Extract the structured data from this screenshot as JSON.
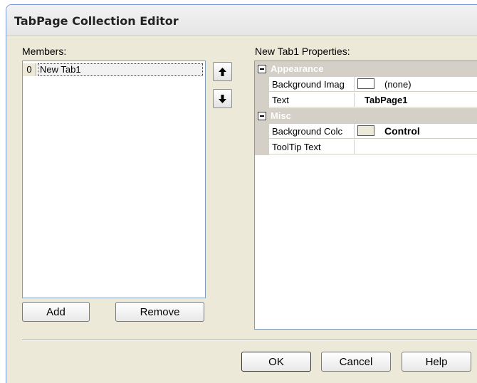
{
  "window": {
    "title": "TabPage Collection Editor"
  },
  "members": {
    "label": "Members:",
    "items": [
      {
        "index": "0",
        "text": "New Tab1"
      }
    ],
    "add_label": "Add",
    "remove_label": "Remove"
  },
  "properties": {
    "label": "New Tab1 Properties:",
    "categories": [
      {
        "name": "Appearance",
        "rows": [
          {
            "name": "Background Imag",
            "value": "(none)",
            "swatch_color": "#ffffff",
            "bold": false
          },
          {
            "name": "Text",
            "value": "TabPage1",
            "bold": true
          }
        ]
      },
      {
        "name": "Misc",
        "rows": [
          {
            "name": "Background Colc",
            "value": "Control",
            "swatch_color": "#ece9d8",
            "bold": true
          },
          {
            "name": "ToolTip Text",
            "value": "",
            "bold": false
          }
        ]
      }
    ]
  },
  "footer": {
    "ok_label": "OK",
    "cancel_label": "Cancel",
    "help_label": "Help"
  },
  "icons": {
    "move_up": "arrow-up-icon",
    "move_down": "arrow-down-icon"
  },
  "colors": {
    "dialog_bg": "#ece9d8",
    "category_bg": "#d4d0c8",
    "list_border": "#7f9db9"
  }
}
